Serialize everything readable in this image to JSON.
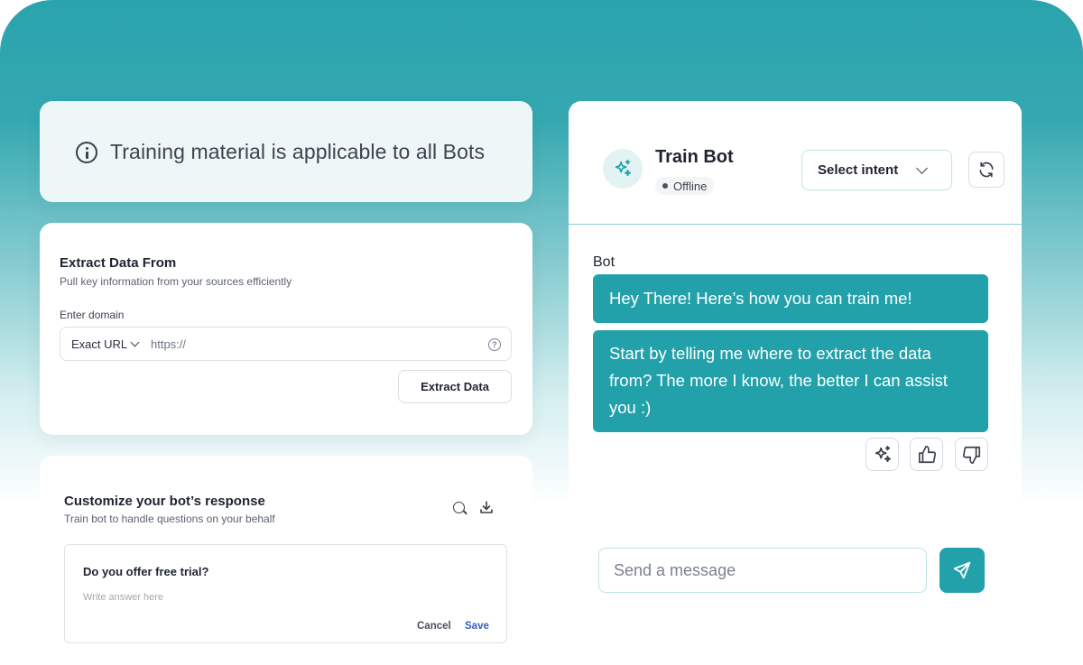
{
  "info_banner": {
    "text": "Training material is applicable to all Bots",
    "icon": "info-icon"
  },
  "extract": {
    "title": "Extract Data From",
    "subtitle": "Pull key information from your sources efficiently",
    "domain_label": "Enter domain",
    "match_type": "Exact URL",
    "url_placeholder": "https://",
    "help_icon": "help-circle-icon",
    "button_label": "Extract Data"
  },
  "customize": {
    "title": "Customize your bot’s response",
    "subtitle": "Train bot to handle questions on your behalf",
    "question": "Do you offer free trial?",
    "answer_placeholder": "Write answer here",
    "cancel_label": "Cancel",
    "save_label": "Save",
    "save_color": "#3b5bbd"
  },
  "chat": {
    "bot_name": "Train Bot",
    "status": "Offline",
    "intent_label": "Select intent",
    "sender": "Bot",
    "messages": [
      "Hey There! Here’s how you can train me!",
      "Start by telling me where to extract the data from? The more I know, the better I can assist you :)"
    ],
    "message_placeholder": "Send a message",
    "icons": {
      "avatar": "sparkle-icon",
      "refresh": "refresh-icon",
      "improve": "sparkle-icon",
      "like": "thumbs-up-icon",
      "dislike": "thumbs-down-icon",
      "send": "send-icon"
    }
  },
  "colors": {
    "accent": "#22a1aa",
    "background_top": "#2aa3ad"
  }
}
